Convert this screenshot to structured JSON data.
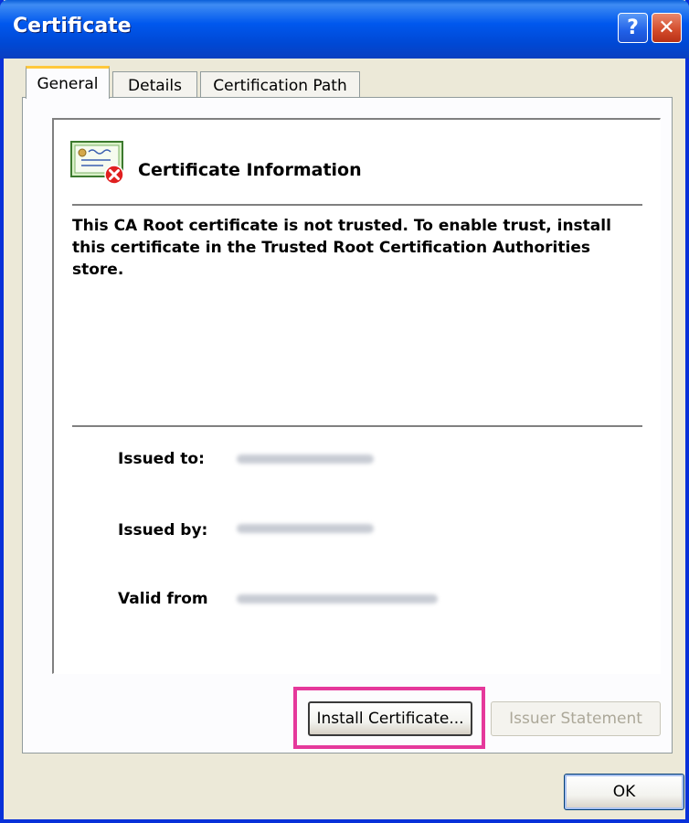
{
  "window": {
    "title": "Certificate",
    "help_label": "?",
    "close_label": "✕"
  },
  "tabs": [
    {
      "label": "General",
      "selected": true
    },
    {
      "label": "Details",
      "selected": false
    },
    {
      "label": "Certification Path",
      "selected": false
    }
  ],
  "info": {
    "icon": "certificate-error-icon",
    "header": "Certificate Information",
    "message": "This CA Root certificate is not trusted. To enable trust, install this certificate in the Trusted Root Certification Authorities store.",
    "fields": [
      {
        "label": "Issued to:"
      },
      {
        "label": "Issued by:"
      },
      {
        "label": "Valid from"
      }
    ]
  },
  "buttons": {
    "install": "Install Certificate...",
    "issuer": "Issuer Statement",
    "ok": "OK"
  },
  "colors": {
    "titlebar": "#0058ee",
    "highlight": "#e5389b",
    "tab_accent": "#ffc83c"
  }
}
